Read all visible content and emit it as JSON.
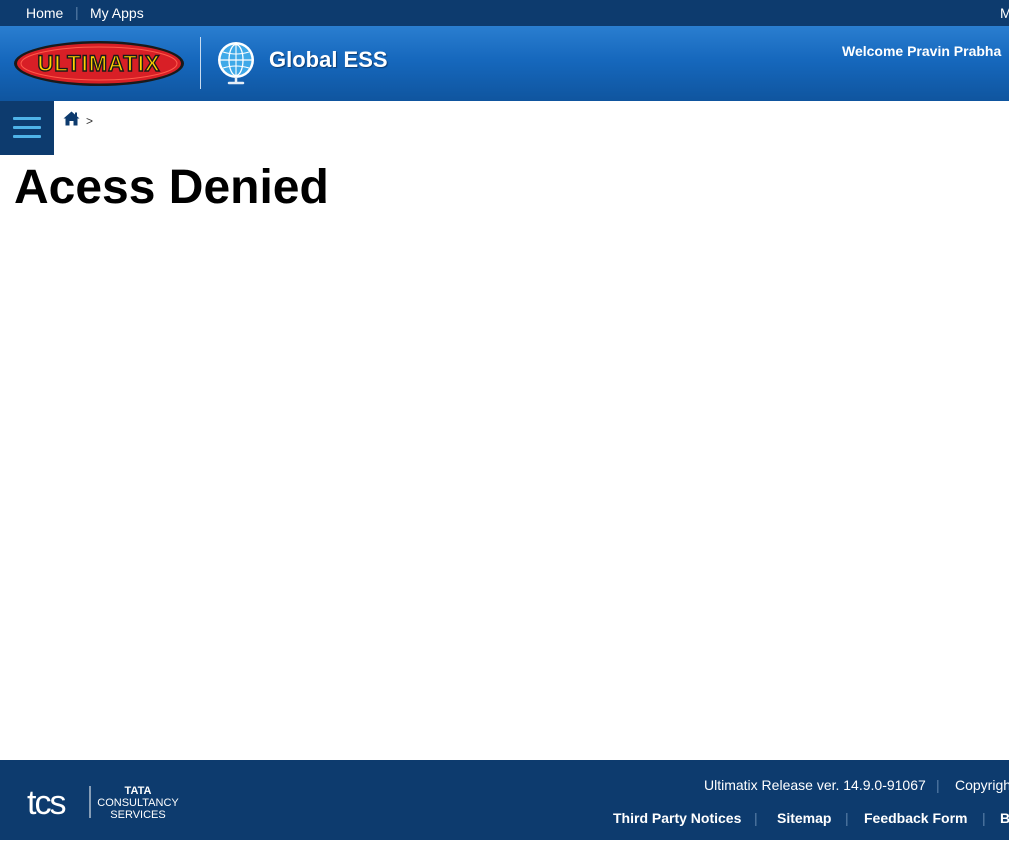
{
  "topbar": {
    "links": [
      "Home",
      "My Apps"
    ],
    "right_link": "M"
  },
  "header": {
    "logo_text": "ULTIMATIX",
    "app_title": "Global ESS",
    "welcome": "Welcome Pravin Prabha"
  },
  "breadcrumb": {
    "icon": "home-icon",
    "separator": ">"
  },
  "main": {
    "title": "Acess Denied"
  },
  "footer": {
    "release": "Ultimatix Release ver. 14.9.0-91067",
    "copyright": "Copyrigh",
    "links": [
      "Third Party Notices",
      "Sitemap",
      "Feedback Form",
      "B"
    ],
    "tcs_logo": {
      "mark": "tcs",
      "line1": "TATA",
      "line2": "CONSULTANCY",
      "line3": "SERVICES"
    }
  },
  "colors": {
    "header_blue": "#1668bd",
    "dark_navy": "#0d3b6e",
    "menu_bar_accent": "#4fb3e8",
    "logo_red": "#d81f26",
    "logo_yellow": "#ffd000"
  }
}
